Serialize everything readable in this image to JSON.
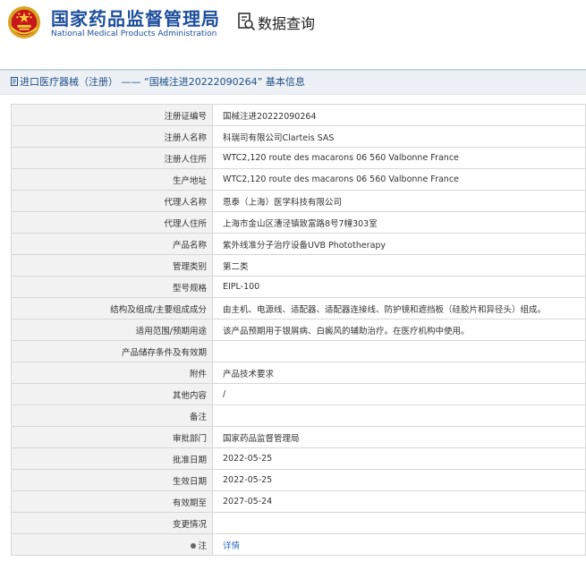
{
  "header": {
    "brand_cn": "国家药品监督管理局",
    "brand_en": "National Medical Products Administration",
    "query_label": "数据查询",
    "brand_color": "#1e4f9c"
  },
  "breadcrumb": {
    "text": "进口医疗器械（注册） —— “国械注进20222090264” 基本信息"
  },
  "table": {
    "rows": [
      {
        "label": "注册证编号",
        "value": "国械注进20222090264"
      },
      {
        "label": "注册人名称",
        "value": "科瑞司有限公司Clarteis SAS"
      },
      {
        "label": "注册人住所",
        "value": "WTC2,120 route des macarons 06 560 Valbonne France"
      },
      {
        "label": "生产地址",
        "value": "WTC2,120 route des macarons 06 560 Valbonne France"
      },
      {
        "label": "代理人名称",
        "value": "恩泰（上海）医学科技有限公司"
      },
      {
        "label": "代理人住所",
        "value": "上海市金山区漕泾镇致富路8号7幢303室"
      },
      {
        "label": "产品名称",
        "value": "紫外线准分子治疗设备UVB Phototherapy"
      },
      {
        "label": "管理类别",
        "value": "第二类"
      },
      {
        "label": "型号规格",
        "value": "EIPL-100"
      },
      {
        "label": "结构及组成/主要组成成分",
        "value": "由主机、电源线、适配器、适配器连接线、防护镜和遮挡板（硅胶片和异径头）组成。"
      },
      {
        "label": "适用范围/预期用途",
        "value": "该产品预期用于银屑病、白癜风的辅助治疗。在医疗机构中使用。"
      },
      {
        "label": "产品储存条件及有效期",
        "value": ""
      },
      {
        "label": "附件",
        "value": "产品技术要求"
      },
      {
        "label": "其他内容",
        "value": "/"
      },
      {
        "label": "备注",
        "value": ""
      },
      {
        "label": "审批部门",
        "value": "国家药品监督管理局"
      },
      {
        "label": "批准日期",
        "value": "2022-05-25"
      },
      {
        "label": "生效日期",
        "value": "2022-05-25"
      },
      {
        "label": "有效期至",
        "value": "2027-05-24"
      },
      {
        "label": "变更情况",
        "value": ""
      }
    ],
    "note_row": {
      "label": "注",
      "link_text": "详情"
    }
  },
  "colors": {
    "label_bg": "#f2f2f2",
    "border": "#d7d7d7",
    "link": "#2a6bc2",
    "breadcrumb_bg": "#edf1f5"
  }
}
